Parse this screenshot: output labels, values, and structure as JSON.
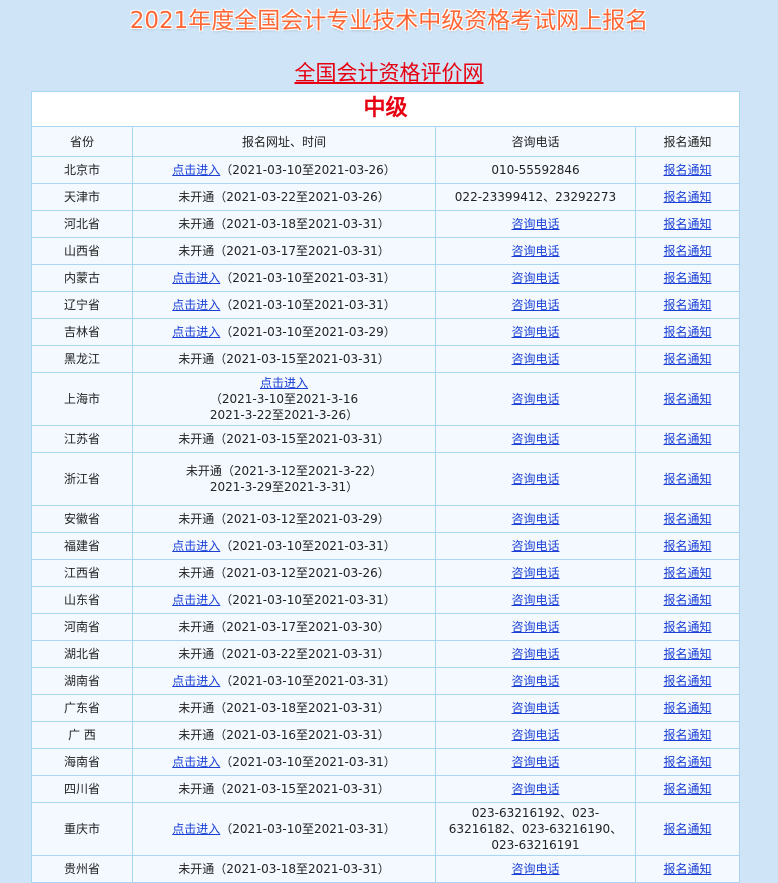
{
  "page_title": "2021年度全国会计专业技术中级资格考试网上报名",
  "org_link": "全国会计资格评价网",
  "level": "中级",
  "headers": [
    "省份",
    "报名网址、时间",
    "咨询电话",
    "报名通知"
  ],
  "rows": [
    {
      "province": "北京市",
      "status": "点击进入",
      "linked": true,
      "dates": "（2021-03-10至2021-03-26）",
      "phone": "010-55592846",
      "phone_linked": false,
      "notice": "报名通知"
    },
    {
      "province": "天津市",
      "status": "未开通",
      "linked": false,
      "dates": "（2021-03-22至2021-03-26）",
      "phone": "022-23399412、23292273",
      "phone_linked": false,
      "notice": "报名通知"
    },
    {
      "province": "河北省",
      "status": "未开通",
      "linked": false,
      "dates": "（2021-03-18至2021-03-31）",
      "phone": "咨询电话",
      "phone_linked": true,
      "notice": "报名通知"
    },
    {
      "province": "山西省",
      "status": "未开通",
      "linked": false,
      "dates": "（2021-03-17至2021-03-31）",
      "phone": "咨询电话",
      "phone_linked": true,
      "notice": "报名通知"
    },
    {
      "province": "内蒙古",
      "status": "点击进入",
      "linked": true,
      "dates": "（2021-03-10至2021-03-31）",
      "phone": "咨询电话",
      "phone_linked": true,
      "notice": "报名通知"
    },
    {
      "province": "辽宁省",
      "status": "点击进入",
      "linked": true,
      "dates": "（2021-03-10至2021-03-31）",
      "phone": "咨询电话",
      "phone_linked": true,
      "notice": "报名通知"
    },
    {
      "province": "吉林省",
      "status": "点击进入",
      "linked": true,
      "dates": "（2021-03-10至2021-03-29）",
      "phone": "咨询电话",
      "phone_linked": true,
      "notice": "报名通知"
    },
    {
      "province": "黑龙江",
      "status": "未开通",
      "linked": false,
      "dates": "（2021-03-15至2021-03-31）",
      "phone": "咨询电话",
      "phone_linked": true,
      "notice": "报名通知"
    },
    {
      "province": "上海市",
      "status": "点击进入",
      "linked": true,
      "dates": "（2021-3-10至2021-3-16",
      "dates2": "2021-3-22至2021-3-26）",
      "phone": "咨询电话",
      "phone_linked": true,
      "notice": "报名通知"
    },
    {
      "province": "江苏省",
      "status": "未开通",
      "linked": false,
      "dates": "（2021-03-15至2021-03-31）",
      "phone": "咨询电话",
      "phone_linked": true,
      "notice": "报名通知"
    },
    {
      "province": "浙江省",
      "status": "未开通",
      "linked": false,
      "dates": "（2021-3-12至2021-3-22）",
      "dates2": "2021-3-29至2021-3-31）",
      "phone": "咨询电话",
      "phone_linked": true,
      "notice": "报名通知"
    },
    {
      "province": "安徽省",
      "status": "未开通",
      "linked": false,
      "dates": "（2021-03-12至2021-03-29）",
      "phone": "咨询电话",
      "phone_linked": true,
      "notice": "报名通知"
    },
    {
      "province": "福建省",
      "status": "点击进入",
      "linked": true,
      "dates": "（2021-03-10至2021-03-31）",
      "phone": "咨询电话",
      "phone_linked": true,
      "notice": "报名通知"
    },
    {
      "province": "江西省",
      "status": "未开通",
      "linked": false,
      "dates": "（2021-03-12至2021-03-26）",
      "phone": "咨询电话",
      "phone_linked": true,
      "notice": "报名通知"
    },
    {
      "province": "山东省",
      "status": "点击进入",
      "linked": true,
      "dates": "（2021-03-10至2021-03-31）",
      "phone": "咨询电话",
      "phone_linked": true,
      "notice": "报名通知"
    },
    {
      "province": "河南省",
      "status": "未开通",
      "linked": false,
      "dates": "（2021-03-17至2021-03-30）",
      "phone": "咨询电话",
      "phone_linked": true,
      "notice": "报名通知"
    },
    {
      "province": "湖北省",
      "status": "未开通",
      "linked": false,
      "dates": "（2021-03-22至2021-03-31）",
      "phone": "咨询电话",
      "phone_linked": true,
      "notice": "报名通知"
    },
    {
      "province": "湖南省",
      "status": "点击进入",
      "linked": true,
      "dates": "（2021-03-10至2021-03-31）",
      "phone": "咨询电话",
      "phone_linked": true,
      "notice": "报名通知"
    },
    {
      "province": "广东省",
      "status": "未开通",
      "linked": false,
      "dates": "（2021-03-18至2021-03-31）",
      "phone": "咨询电话",
      "phone_linked": true,
      "notice": "报名通知"
    },
    {
      "province": "广 西",
      "status": "未开通",
      "linked": false,
      "dates": "（2021-03-16至2021-03-31）",
      "phone": "咨询电话",
      "phone_linked": true,
      "notice": "报名通知"
    },
    {
      "province": "海南省",
      "status": "点击进入",
      "linked": true,
      "dates": "（2021-03-10至2021-03-31）",
      "phone": "咨询电话",
      "phone_linked": true,
      "notice": "报名通知"
    },
    {
      "province": "四川省",
      "status": "未开通",
      "linked": false,
      "dates": "（2021-03-15至2021-03-31）",
      "phone": "咨询电话",
      "phone_linked": true,
      "notice": "报名通知"
    },
    {
      "province": "重庆市",
      "status": "点击进入",
      "linked": true,
      "dates": "（2021-03-10至2021-03-31）",
      "phone": "023-63216192、023-63216182、023-63216190、023-63216191",
      "phone_linked": false,
      "notice": "报名通知"
    },
    {
      "province": "贵州省",
      "status": "未开通",
      "linked": false,
      "dates": "（2021-03-18至2021-03-31）",
      "phone": "咨询电话",
      "phone_linked": true,
      "notice": "报名通知"
    }
  ],
  "colors": {
    "title": "#ff6633",
    "org_link": "#e60012",
    "level": "#e60012",
    "link": "#1a3fd6",
    "border": "#a9d6f0",
    "background": "#cfe5f7",
    "table_bg": "#f3f9ff"
  }
}
